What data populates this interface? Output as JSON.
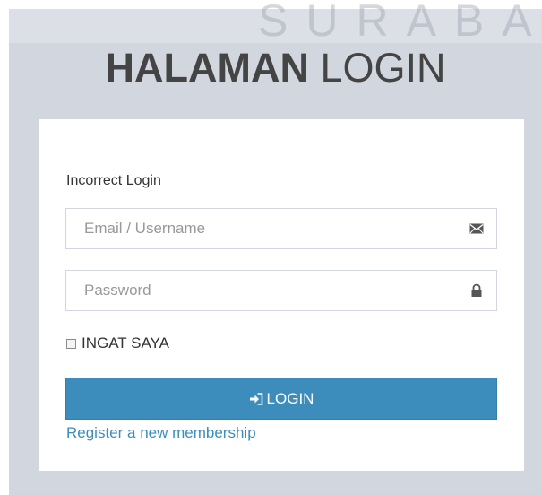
{
  "app": {
    "title_bold": "HALAMAN",
    "title_light": " LOGIN",
    "watermark": "SURABA"
  },
  "form": {
    "message": "Incorrect Login",
    "email": {
      "placeholder": "Email / Username",
      "value": "",
      "icon": "envelope-icon"
    },
    "password": {
      "placeholder": "Password",
      "value": "",
      "icon": "lock-icon"
    },
    "remember": {
      "label": "INGAT SAYA",
      "checked": false
    },
    "login_button": {
      "label": "LOGIN",
      "icon": "sign-in-icon"
    },
    "register_link": "Register a new membership"
  },
  "colors": {
    "page_background": "#d2d6de",
    "box_background": "#ffffff",
    "primary": "#3c8dbc",
    "text": "#333333",
    "title": "#444444"
  }
}
